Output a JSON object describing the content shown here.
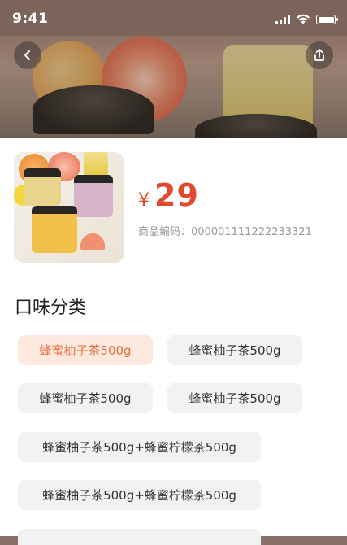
{
  "status_bar": {
    "time": "9:41"
  },
  "header": {
    "back_icon": "chevron-left-icon",
    "share_icon": "share-icon"
  },
  "product": {
    "price_symbol": "¥",
    "price": "29",
    "code_label": "商品编码：",
    "code": "000001111222233321"
  },
  "flavors": {
    "title": "口味分类",
    "options": [
      {
        "label": "蜂蜜柚子茶500g",
        "selected": true
      },
      {
        "label": "蜂蜜柚子茶500g",
        "selected": false
      },
      {
        "label": "蜂蜜柚子茶500g",
        "selected": false
      },
      {
        "label": "蜂蜜柚子茶500g",
        "selected": false
      },
      {
        "label": "蜂蜜柚子茶500g+蜂蜜柠檬茶500g",
        "selected": false
      },
      {
        "label": "蜂蜜柚子茶500g+蜂蜜柠檬茶500g",
        "selected": false
      }
    ]
  },
  "colors": {
    "accent": "#ea6f3e",
    "price": "#e04a2e",
    "chip_bg": "#f2f2f2",
    "chip_selected_bg": "#fde9df"
  }
}
